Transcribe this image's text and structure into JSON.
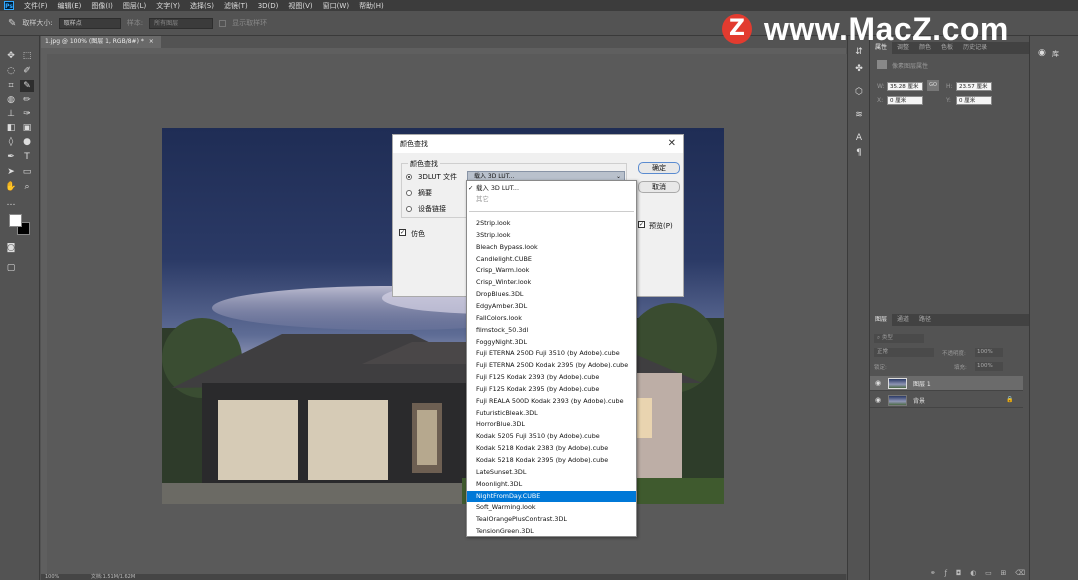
{
  "menubar": {
    "items": [
      "文件(F)",
      "编辑(E)",
      "图像(I)",
      "图层(L)",
      "文字(Y)",
      "选择(S)",
      "滤镜(T)",
      "3D(D)",
      "视图(V)",
      "窗口(W)",
      "帮助(H)"
    ]
  },
  "options": {
    "sample_size_label": "取样大小:",
    "sample_size_value": "取样点",
    "sample_label": "样本:",
    "sample_value": "所有图层",
    "show_ring": "显示取样环"
  },
  "document": {
    "tab_title": "1.jpg @ 100% (图层 1, RGB/8#) *",
    "close": "×",
    "zoom": "100%",
    "doc_info": "文档:1.51M/1.62M"
  },
  "dialog": {
    "title": "颜色查找",
    "group_label": "颜色查找",
    "opt_3dlut": "3DLUT 文件",
    "opt_abstract": "摘要",
    "opt_device_link": "设备链接",
    "combo_value": "载入 3D LUT...",
    "ok": "确定",
    "cancel": "取消",
    "dither": "仿色",
    "preview": "预览(P)"
  },
  "dropdown": {
    "load_item": "载入 3D LUT...",
    "other_item": "其它",
    "items": [
      "2Strip.look",
      "3Strip.look",
      "Bleach Bypass.look",
      "Candlelight.CUBE",
      "Crisp_Warm.look",
      "Crisp_Winter.look",
      "DropBlues.3DL",
      "EdgyAmber.3DL",
      "FallColors.look",
      "filmstock_50.3dl",
      "FoggyNight.3DL",
      "Fuji ETERNA 250D Fuji 3510 (by Adobe).cube",
      "Fuji ETERNA 250D Kodak 2395 (by Adobe).cube",
      "Fuji F125 Kodak 2393 (by Adobe).cube",
      "Fuji F125 Kodak 2395 (by Adobe).cube",
      "Fuji REALA 500D Kodak 2393 (by Adobe).cube",
      "FuturisticBleak.3DL",
      "HorrorBlue.3DL",
      "Kodak 5205 Fuji 3510 (by Adobe).cube",
      "Kodak 5218 Kodak 2383 (by Adobe).cube",
      "Kodak 5218 Kodak 2395 (by Adobe).cube",
      "LateSunset.3DL",
      "Moonlight.3DL",
      "NightFromDay.CUBE",
      "Soft_Warming.look",
      "TealOrangePlusContrast.3DL",
      "TensionGreen.3DL"
    ],
    "selected": "NightFromDay.CUBE"
  },
  "properties": {
    "tabs": [
      "属性",
      "调整",
      "颜色",
      "色板",
      "历史记录"
    ],
    "layer_type": "像素图层属性",
    "w_label": "W:",
    "w_value": "35.28 厘米",
    "link": "GO",
    "h_label": "H:",
    "h_value": "23.57 厘米",
    "x_label": "X:",
    "x_value": "0 厘米",
    "y_label": "Y:",
    "y_value": "0 厘米"
  },
  "layers": {
    "tabs": [
      "图层",
      "通道",
      "路径"
    ],
    "filter": "类型",
    "blend": "正常",
    "opacity_label": "不透明度:",
    "opacity": "100%",
    "lock_label": "锁定:",
    "fill_label": "填充:",
    "fill": "100%",
    "items": [
      {
        "name": "图层 1"
      },
      {
        "name": "背景"
      }
    ]
  },
  "right_strip": {
    "library": "库"
  },
  "watermark": {
    "logo": "Z",
    "text": "www.MacZ.com"
  }
}
